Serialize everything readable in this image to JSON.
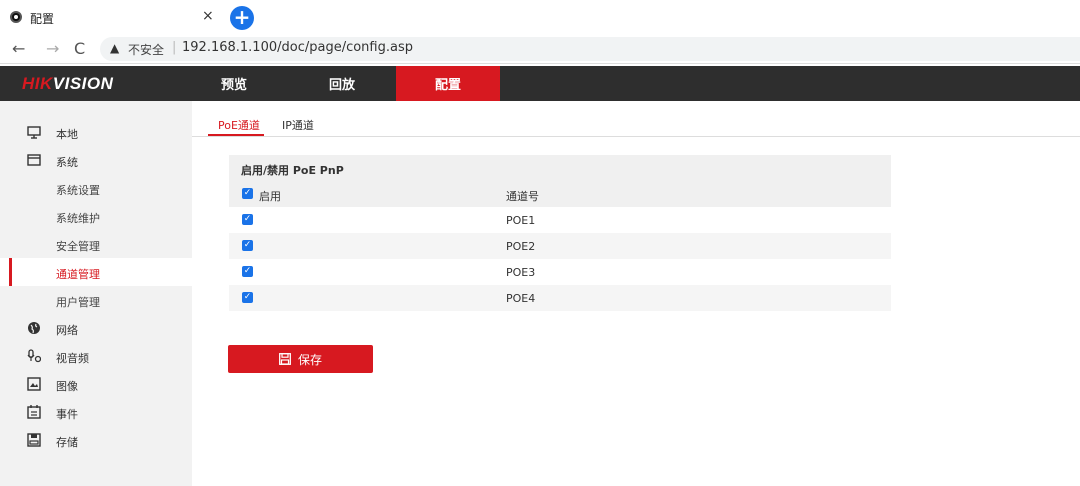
{
  "browser": {
    "tab_title": "配置",
    "close_glyph": "×",
    "newtab_glyph": "+",
    "nav": {
      "back": "←",
      "forward": "→",
      "reload": "C"
    },
    "security_label": "不安全",
    "separator": "|",
    "url": "192.168.1.100/doc/page/config.asp"
  },
  "header": {
    "logo_part1": "HIK",
    "logo_part2": "VISION",
    "nav": [
      "预览",
      "回放",
      "配置"
    ],
    "active_nav": "配置",
    "accent_color": "#d71920"
  },
  "sidebar": {
    "items": [
      {
        "label": "本地",
        "icon": "monitor-icon"
      },
      {
        "label": "系统",
        "icon": "window-icon"
      },
      {
        "label": "系统设置",
        "sub": true
      },
      {
        "label": "系统维护",
        "sub": true
      },
      {
        "label": "安全管理",
        "sub": true
      },
      {
        "label": "通道管理",
        "sub": true,
        "active": true
      },
      {
        "label": "用户管理",
        "sub": true
      },
      {
        "label": "网络",
        "icon": "globe-icon"
      },
      {
        "label": "视音频",
        "icon": "microphone-icon"
      },
      {
        "label": "图像",
        "icon": "image-icon"
      },
      {
        "label": "事件",
        "icon": "calendar-icon"
      },
      {
        "label": "存储",
        "icon": "storage-icon"
      }
    ]
  },
  "subtabs": [
    "PoE通道",
    "IP通道"
  ],
  "panel": {
    "title": "启用/禁用 PoE PnP",
    "col_enable": "启用",
    "col_channel": "通道号",
    "rows": [
      {
        "enabled": true,
        "channel": "POE1"
      },
      {
        "enabled": true,
        "channel": "POE2"
      },
      {
        "enabled": true,
        "channel": "POE3"
      },
      {
        "enabled": true,
        "channel": "POE4"
      }
    ],
    "check_glyph": "✓"
  },
  "save_label": "保存"
}
